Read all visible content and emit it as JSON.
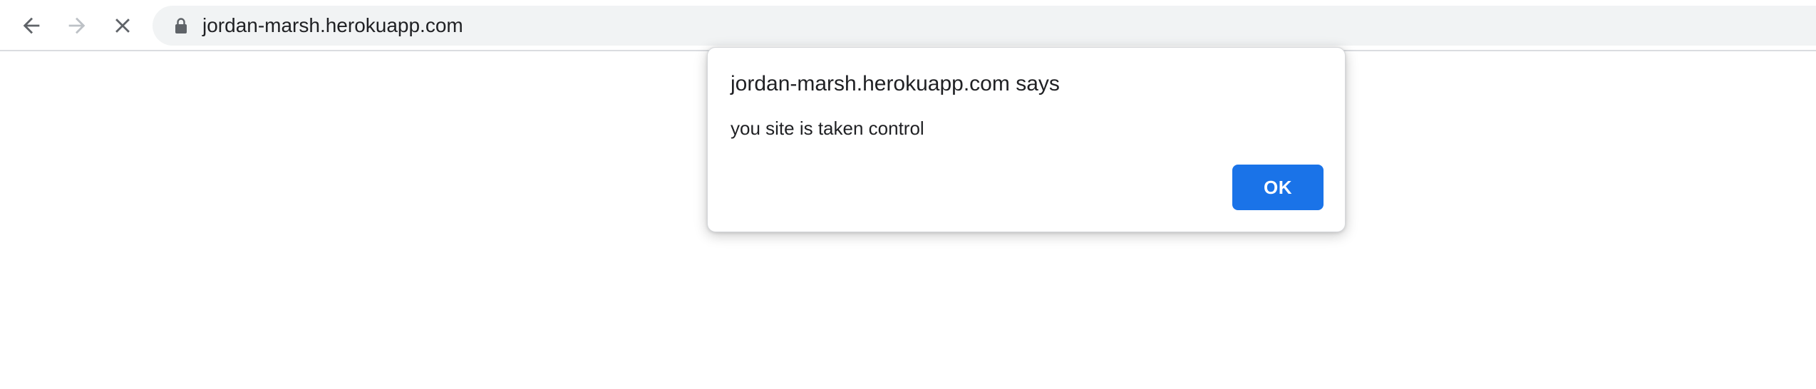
{
  "browser": {
    "nav": {
      "back_icon": "arrow-left-icon",
      "forward_icon": "arrow-right-icon",
      "stop_icon": "close-icon",
      "forward_enabled": false
    },
    "omnibox": {
      "lock_icon": "lock-icon",
      "url": "jordan-marsh.herokuapp.com"
    }
  },
  "alert": {
    "title": "jordan-marsh.herokuapp.com says",
    "message": "you site is taken control",
    "ok_label": "OK"
  },
  "colors": {
    "accent": "#1a73e8",
    "omnibox_bg": "#f1f3f4",
    "icon_active": "#5f6368",
    "icon_disabled": "#bdc1c6",
    "text": "#202124"
  }
}
